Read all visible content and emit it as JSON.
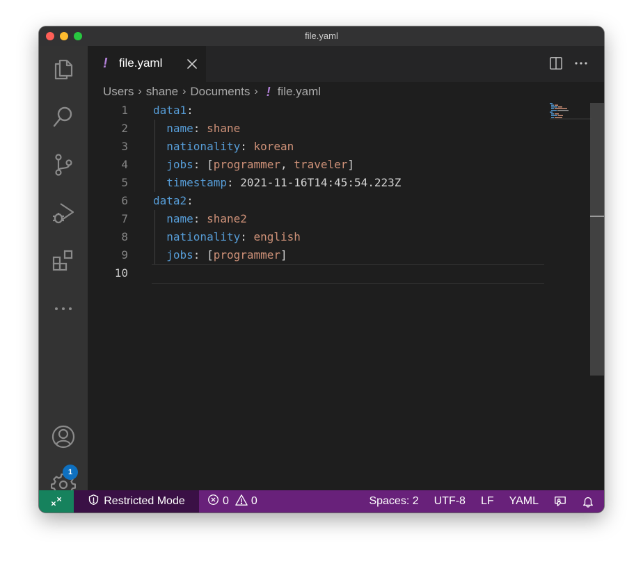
{
  "window": {
    "title": "file.yaml"
  },
  "tab": {
    "icon": "!",
    "label": "file.yaml"
  },
  "breadcrumb": {
    "items": [
      "Users",
      "shane",
      "Documents"
    ],
    "file_icon": "!",
    "file": "file.yaml"
  },
  "editor": {
    "active_line": 10,
    "line_numbers": [
      "1",
      "2",
      "3",
      "4",
      "5",
      "6",
      "7",
      "8",
      "9",
      "10"
    ],
    "lines": [
      {
        "tokens": [
          {
            "t": "k",
            "s": "data1"
          },
          {
            "t": "p",
            "s": ":"
          }
        ]
      },
      {
        "tokens": [
          {
            "t": "k",
            "s": "  name"
          },
          {
            "t": "p",
            "s": ": "
          },
          {
            "t": "v",
            "s": "shane"
          }
        ]
      },
      {
        "tokens": [
          {
            "t": "k",
            "s": "  nationality"
          },
          {
            "t": "p",
            "s": ": "
          },
          {
            "t": "v",
            "s": "korean"
          }
        ]
      },
      {
        "tokens": [
          {
            "t": "k",
            "s": "  jobs"
          },
          {
            "t": "p",
            "s": ": ["
          },
          {
            "t": "v",
            "s": "programmer"
          },
          {
            "t": "p",
            "s": ", "
          },
          {
            "t": "v",
            "s": "traveler"
          },
          {
            "t": "p",
            "s": "]"
          }
        ]
      },
      {
        "tokens": [
          {
            "t": "k",
            "s": "  timestamp"
          },
          {
            "t": "p",
            "s": ": 2021-11-16T14:45:54.223Z"
          }
        ]
      },
      {
        "tokens": [
          {
            "t": "k",
            "s": "data2"
          },
          {
            "t": "p",
            "s": ":"
          }
        ]
      },
      {
        "tokens": [
          {
            "t": "k",
            "s": "  name"
          },
          {
            "t": "p",
            "s": ": "
          },
          {
            "t": "v",
            "s": "shane2"
          }
        ]
      },
      {
        "tokens": [
          {
            "t": "k",
            "s": "  nationality"
          },
          {
            "t": "p",
            "s": ": "
          },
          {
            "t": "v",
            "s": "english"
          }
        ]
      },
      {
        "tokens": [
          {
            "t": "k",
            "s": "  jobs"
          },
          {
            "t": "p",
            "s": ": ["
          },
          {
            "t": "v",
            "s": "programmer"
          },
          {
            "t": "p",
            "s": "]"
          }
        ]
      },
      {
        "tokens": []
      }
    ]
  },
  "activity_bar": {
    "settings_badge": "1"
  },
  "statusbar": {
    "restricted_mode": "Restricted Mode",
    "errors": "0",
    "warnings": "0",
    "spaces": "Spaces: 2",
    "encoding": "UTF-8",
    "eol": "LF",
    "language": "YAML"
  },
  "colors": {
    "keyword": "#569cd6",
    "string": "#ce9178",
    "statusbar": "#68217a",
    "remote": "#16825d",
    "yaml_icon": "#b180d7"
  }
}
